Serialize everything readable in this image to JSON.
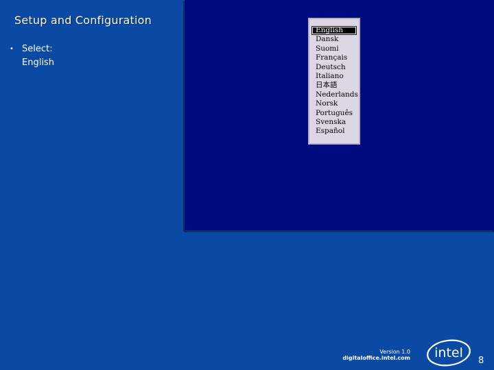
{
  "slide": {
    "title": "Setup and Configuration",
    "bullet_label": "Select:",
    "bullet_value": "English"
  },
  "language_menu": {
    "items": [
      "English",
      "Dansk",
      "Suomi",
      "Français",
      "Deutsch",
      "Italiano",
      "日本語",
      "Nederlands",
      "Norsk",
      "Português",
      "Svenska",
      "Español"
    ],
    "selected": "English"
  },
  "footer": {
    "version": "Version 1.0",
    "url": "digitaloffice.intel.com",
    "logo_text": "intel",
    "page_number": "8"
  },
  "colors": {
    "slide_background": "#0a49a4",
    "screen_background": "#000c7e",
    "menu_background": "#ddd6e4"
  }
}
